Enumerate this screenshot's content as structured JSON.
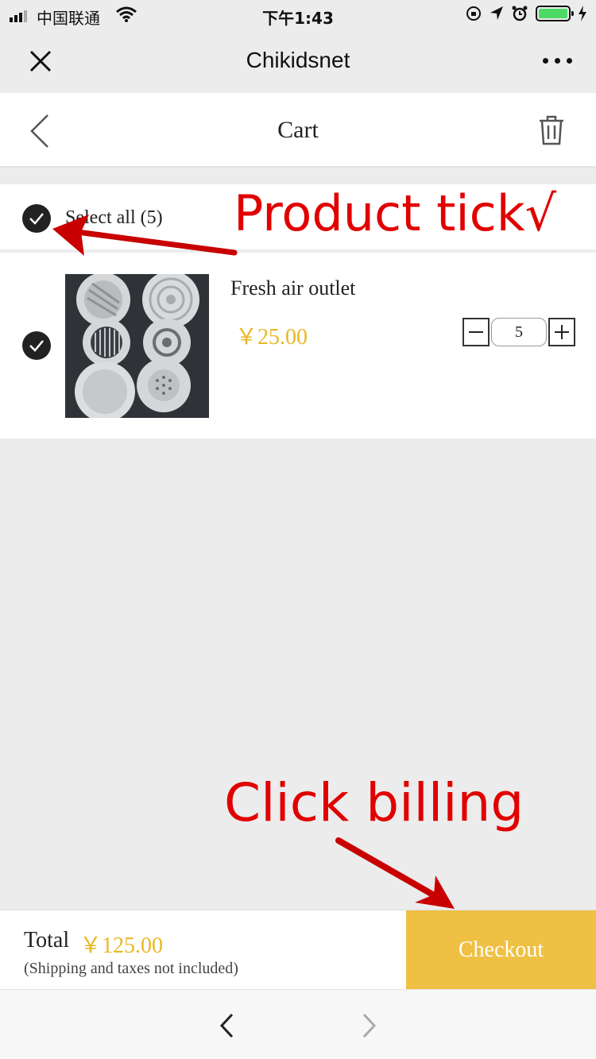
{
  "status_bar": {
    "carrier": "中国联通",
    "time": "下午1:43"
  },
  "app_header": {
    "title": "Chikidsnet"
  },
  "cart_header": {
    "title": "Cart"
  },
  "cart": {
    "select_all_label": "Select all (5)",
    "select_all_checked": true,
    "items": [
      {
        "name": "Fresh air outlet",
        "price": "￥25.00",
        "quantity": "5",
        "checked": true
      }
    ]
  },
  "footer": {
    "total_label": "Total",
    "total_value": "￥125.00",
    "shipping_note": "(Shipping and taxes not included)",
    "checkout_label": "Checkout"
  },
  "annotations": {
    "tick": "Product tick√",
    "billing": "Click billing"
  },
  "colors": {
    "accent": "#f0c044",
    "price": "#e9b824",
    "annotation": "#e10000",
    "background": "#ececec"
  }
}
